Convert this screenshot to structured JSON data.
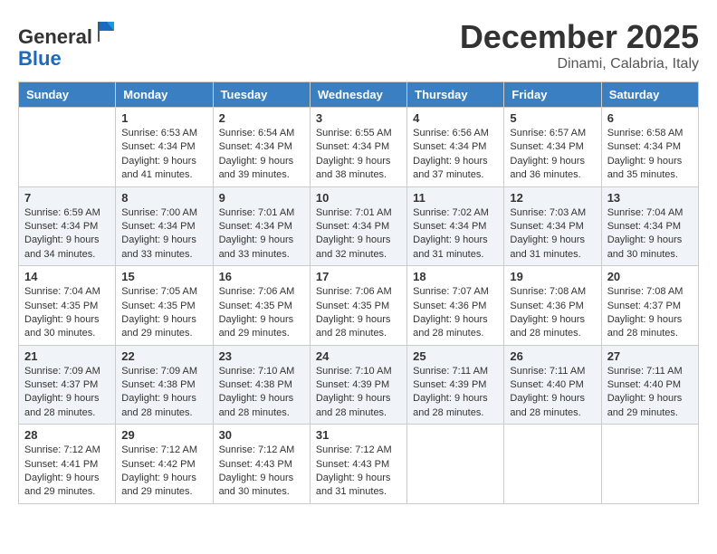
{
  "header": {
    "logo_line1": "General",
    "logo_line2": "Blue",
    "month": "December 2025",
    "location": "Dinami, Calabria, Italy"
  },
  "weekdays": [
    "Sunday",
    "Monday",
    "Tuesday",
    "Wednesday",
    "Thursday",
    "Friday",
    "Saturday"
  ],
  "weeks": [
    [
      {
        "day": "",
        "sunrise": "",
        "sunset": "",
        "daylight": ""
      },
      {
        "day": "1",
        "sunrise": "Sunrise: 6:53 AM",
        "sunset": "Sunset: 4:34 PM",
        "daylight": "Daylight: 9 hours and 41 minutes."
      },
      {
        "day": "2",
        "sunrise": "Sunrise: 6:54 AM",
        "sunset": "Sunset: 4:34 PM",
        "daylight": "Daylight: 9 hours and 39 minutes."
      },
      {
        "day": "3",
        "sunrise": "Sunrise: 6:55 AM",
        "sunset": "Sunset: 4:34 PM",
        "daylight": "Daylight: 9 hours and 38 minutes."
      },
      {
        "day": "4",
        "sunrise": "Sunrise: 6:56 AM",
        "sunset": "Sunset: 4:34 PM",
        "daylight": "Daylight: 9 hours and 37 minutes."
      },
      {
        "day": "5",
        "sunrise": "Sunrise: 6:57 AM",
        "sunset": "Sunset: 4:34 PM",
        "daylight": "Daylight: 9 hours and 36 minutes."
      },
      {
        "day": "6",
        "sunrise": "Sunrise: 6:58 AM",
        "sunset": "Sunset: 4:34 PM",
        "daylight": "Daylight: 9 hours and 35 minutes."
      }
    ],
    [
      {
        "day": "7",
        "sunrise": "Sunrise: 6:59 AM",
        "sunset": "Sunset: 4:34 PM",
        "daylight": "Daylight: 9 hours and 34 minutes."
      },
      {
        "day": "8",
        "sunrise": "Sunrise: 7:00 AM",
        "sunset": "Sunset: 4:34 PM",
        "daylight": "Daylight: 9 hours and 33 minutes."
      },
      {
        "day": "9",
        "sunrise": "Sunrise: 7:01 AM",
        "sunset": "Sunset: 4:34 PM",
        "daylight": "Daylight: 9 hours and 33 minutes."
      },
      {
        "day": "10",
        "sunrise": "Sunrise: 7:01 AM",
        "sunset": "Sunset: 4:34 PM",
        "daylight": "Daylight: 9 hours and 32 minutes."
      },
      {
        "day": "11",
        "sunrise": "Sunrise: 7:02 AM",
        "sunset": "Sunset: 4:34 PM",
        "daylight": "Daylight: 9 hours and 31 minutes."
      },
      {
        "day": "12",
        "sunrise": "Sunrise: 7:03 AM",
        "sunset": "Sunset: 4:34 PM",
        "daylight": "Daylight: 9 hours and 31 minutes."
      },
      {
        "day": "13",
        "sunrise": "Sunrise: 7:04 AM",
        "sunset": "Sunset: 4:34 PM",
        "daylight": "Daylight: 9 hours and 30 minutes."
      }
    ],
    [
      {
        "day": "14",
        "sunrise": "Sunrise: 7:04 AM",
        "sunset": "Sunset: 4:35 PM",
        "daylight": "Daylight: 9 hours and 30 minutes."
      },
      {
        "day": "15",
        "sunrise": "Sunrise: 7:05 AM",
        "sunset": "Sunset: 4:35 PM",
        "daylight": "Daylight: 9 hours and 29 minutes."
      },
      {
        "day": "16",
        "sunrise": "Sunrise: 7:06 AM",
        "sunset": "Sunset: 4:35 PM",
        "daylight": "Daylight: 9 hours and 29 minutes."
      },
      {
        "day": "17",
        "sunrise": "Sunrise: 7:06 AM",
        "sunset": "Sunset: 4:35 PM",
        "daylight": "Daylight: 9 hours and 28 minutes."
      },
      {
        "day": "18",
        "sunrise": "Sunrise: 7:07 AM",
        "sunset": "Sunset: 4:36 PM",
        "daylight": "Daylight: 9 hours and 28 minutes."
      },
      {
        "day": "19",
        "sunrise": "Sunrise: 7:08 AM",
        "sunset": "Sunset: 4:36 PM",
        "daylight": "Daylight: 9 hours and 28 minutes."
      },
      {
        "day": "20",
        "sunrise": "Sunrise: 7:08 AM",
        "sunset": "Sunset: 4:37 PM",
        "daylight": "Daylight: 9 hours and 28 minutes."
      }
    ],
    [
      {
        "day": "21",
        "sunrise": "Sunrise: 7:09 AM",
        "sunset": "Sunset: 4:37 PM",
        "daylight": "Daylight: 9 hours and 28 minutes."
      },
      {
        "day": "22",
        "sunrise": "Sunrise: 7:09 AM",
        "sunset": "Sunset: 4:38 PM",
        "daylight": "Daylight: 9 hours and 28 minutes."
      },
      {
        "day": "23",
        "sunrise": "Sunrise: 7:10 AM",
        "sunset": "Sunset: 4:38 PM",
        "daylight": "Daylight: 9 hours and 28 minutes."
      },
      {
        "day": "24",
        "sunrise": "Sunrise: 7:10 AM",
        "sunset": "Sunset: 4:39 PM",
        "daylight": "Daylight: 9 hours and 28 minutes."
      },
      {
        "day": "25",
        "sunrise": "Sunrise: 7:11 AM",
        "sunset": "Sunset: 4:39 PM",
        "daylight": "Daylight: 9 hours and 28 minutes."
      },
      {
        "day": "26",
        "sunrise": "Sunrise: 7:11 AM",
        "sunset": "Sunset: 4:40 PM",
        "daylight": "Daylight: 9 hours and 28 minutes."
      },
      {
        "day": "27",
        "sunrise": "Sunrise: 7:11 AM",
        "sunset": "Sunset: 4:40 PM",
        "daylight": "Daylight: 9 hours and 29 minutes."
      }
    ],
    [
      {
        "day": "28",
        "sunrise": "Sunrise: 7:12 AM",
        "sunset": "Sunset: 4:41 PM",
        "daylight": "Daylight: 9 hours and 29 minutes."
      },
      {
        "day": "29",
        "sunrise": "Sunrise: 7:12 AM",
        "sunset": "Sunset: 4:42 PM",
        "daylight": "Daylight: 9 hours and 29 minutes."
      },
      {
        "day": "30",
        "sunrise": "Sunrise: 7:12 AM",
        "sunset": "Sunset: 4:43 PM",
        "daylight": "Daylight: 9 hours and 30 minutes."
      },
      {
        "day": "31",
        "sunrise": "Sunrise: 7:12 AM",
        "sunset": "Sunset: 4:43 PM",
        "daylight": "Daylight: 9 hours and 31 minutes."
      },
      {
        "day": "",
        "sunrise": "",
        "sunset": "",
        "daylight": ""
      },
      {
        "day": "",
        "sunrise": "",
        "sunset": "",
        "daylight": ""
      },
      {
        "day": "",
        "sunrise": "",
        "sunset": "",
        "daylight": ""
      }
    ]
  ]
}
